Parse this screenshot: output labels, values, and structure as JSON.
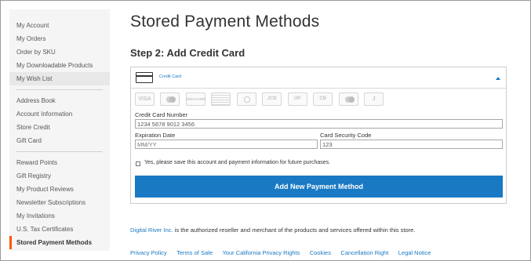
{
  "page": {
    "title": "Stored Payment Methods"
  },
  "sidebar": {
    "groups": [
      [
        "My Account",
        "My Orders",
        "Order by SKU",
        "My Downloadable Products",
        "My Wish List"
      ],
      [
        "Address Book",
        "Account Information",
        "Store Credit",
        "Gift Card"
      ],
      [
        "Reward Points",
        "Gift Registry",
        "My Product Reviews",
        "Newsletter Subscriptions",
        "My Invitations",
        "U.S. Tax Certificates",
        "Stored Payment Methods"
      ]
    ],
    "highlighted": "My Wish List",
    "active": "Stored Payment Methods"
  },
  "step": {
    "title": "Step 2: Add Credit Card"
  },
  "panel": {
    "header_label": "Credit Card",
    "card_logos": [
      "VISA",
      "Mastercard",
      "DISCOVER",
      "American Express",
      "Diners Club",
      "JCB",
      "UnionPay",
      "Carte Bancaire",
      "Maestro",
      "JCB alt"
    ]
  },
  "form": {
    "card_number": {
      "label": "Credit Card Number",
      "value": "1234 5678 9012 3456"
    },
    "expiration": {
      "label": "Expiration Date",
      "value": "MM/YY"
    },
    "security_code": {
      "label": "Card Security Code",
      "value": "123"
    },
    "save_checkbox_label": "Yes, please save this account and payment information for future purchases.",
    "submit_label": "Add New Payment Method"
  },
  "notice": {
    "link": "Digital River Inc.",
    "text": " is the authorized reseller and merchant of the products and services offered within this store."
  },
  "footer": {
    "links": [
      "Privacy Policy",
      "Terms of Sale",
      "Your California Privacy Rights",
      "Cookies",
      "Cancellation Right",
      "Legal Notice"
    ]
  },
  "colors": {
    "accent": "#1979c3",
    "active_marker": "#ff5501",
    "sidebar_bg": "#f5f5f5"
  }
}
